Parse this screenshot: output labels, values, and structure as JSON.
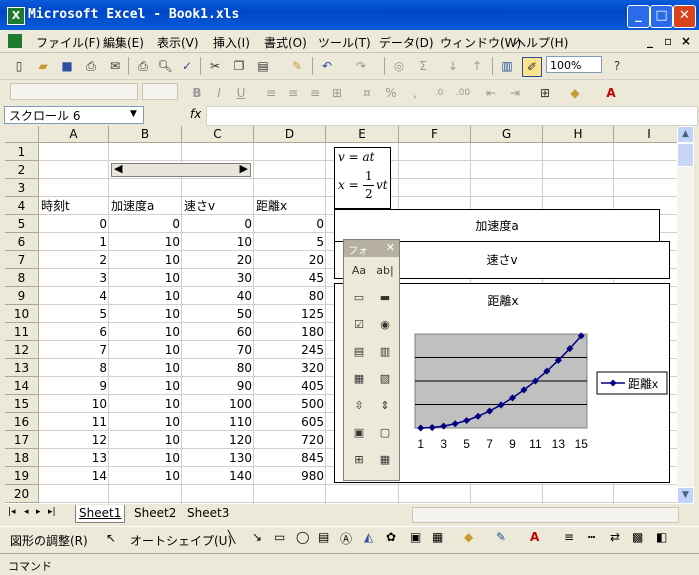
{
  "window": {
    "title": "Microsoft Excel - Book1.xls",
    "icon": "excel-icon"
  },
  "menu": [
    "ファイル(F)",
    "編集(E)",
    "表示(V)",
    "挿入(I)",
    "書式(O)",
    "ツール(T)",
    "データ(D)",
    "ウィンドウ(W)",
    "ヘルプ(H)"
  ],
  "toolbar": {
    "zoom": "100%"
  },
  "namebox": "スクロール 6",
  "fx_label": "fx",
  "columns": [
    "A",
    "B",
    "C",
    "D",
    "E",
    "F",
    "G",
    "H",
    "I"
  ],
  "rows": [
    "1",
    "2",
    "3",
    "4",
    "5",
    "6",
    "7",
    "8",
    "9",
    "10",
    "11",
    "12",
    "13",
    "14",
    "15",
    "16",
    "17",
    "18",
    "19",
    "20"
  ],
  "headers": {
    "a": "時刻t",
    "b": "加速度a",
    "c": "速さv",
    "d": "距離x"
  },
  "table": [
    [
      0,
      0,
      0,
      0
    ],
    [
      1,
      10,
      10,
      5
    ],
    [
      2,
      10,
      20,
      20
    ],
    [
      3,
      10,
      30,
      45
    ],
    [
      4,
      10,
      40,
      80
    ],
    [
      5,
      10,
      50,
      125
    ],
    [
      6,
      10,
      60,
      180
    ],
    [
      7,
      10,
      70,
      245
    ],
    [
      8,
      10,
      80,
      320
    ],
    [
      9,
      10,
      90,
      405
    ],
    [
      10,
      10,
      100,
      500
    ],
    [
      11,
      10,
      110,
      605
    ],
    [
      12,
      10,
      120,
      720
    ],
    [
      13,
      10,
      130,
      845
    ],
    [
      14,
      10,
      140,
      980
    ]
  ],
  "formula": {
    "line1": "v = at",
    "line2_lhs": "x =",
    "frac_num": "1",
    "frac_den": "2",
    "line2_rhs": "vt"
  },
  "buttons": {
    "accel": "加速度a",
    "speed": "速さv"
  },
  "chart_data": {
    "type": "line",
    "title": "距離x",
    "x": [
      "1",
      "2",
      "3",
      "4",
      "5",
      "6",
      "7",
      "8",
      "9",
      "10",
      "11",
      "12",
      "13",
      "14",
      "15"
    ],
    "x_tick_labels": [
      "1",
      "3",
      "5",
      "7",
      "9",
      "11",
      "13",
      "15"
    ],
    "series": [
      {
        "name": "距離x",
        "values": [
          0,
          5,
          20,
          45,
          80,
          125,
          180,
          245,
          320,
          405,
          500,
          605,
          720,
          845,
          980
        ]
      }
    ],
    "ylim": [
      0,
      1000
    ],
    "grid": true,
    "legend": "right",
    "color": "#000080"
  },
  "forms_toolbar": {
    "title": "フォ"
  },
  "sheets": [
    "Sheet1",
    "Sheet2",
    "Sheet3"
  ],
  "drawbar": {
    "draw": "図形の調整(R)",
    "autoshape": "オートシェイプ(U)"
  },
  "status": "コマンド"
}
